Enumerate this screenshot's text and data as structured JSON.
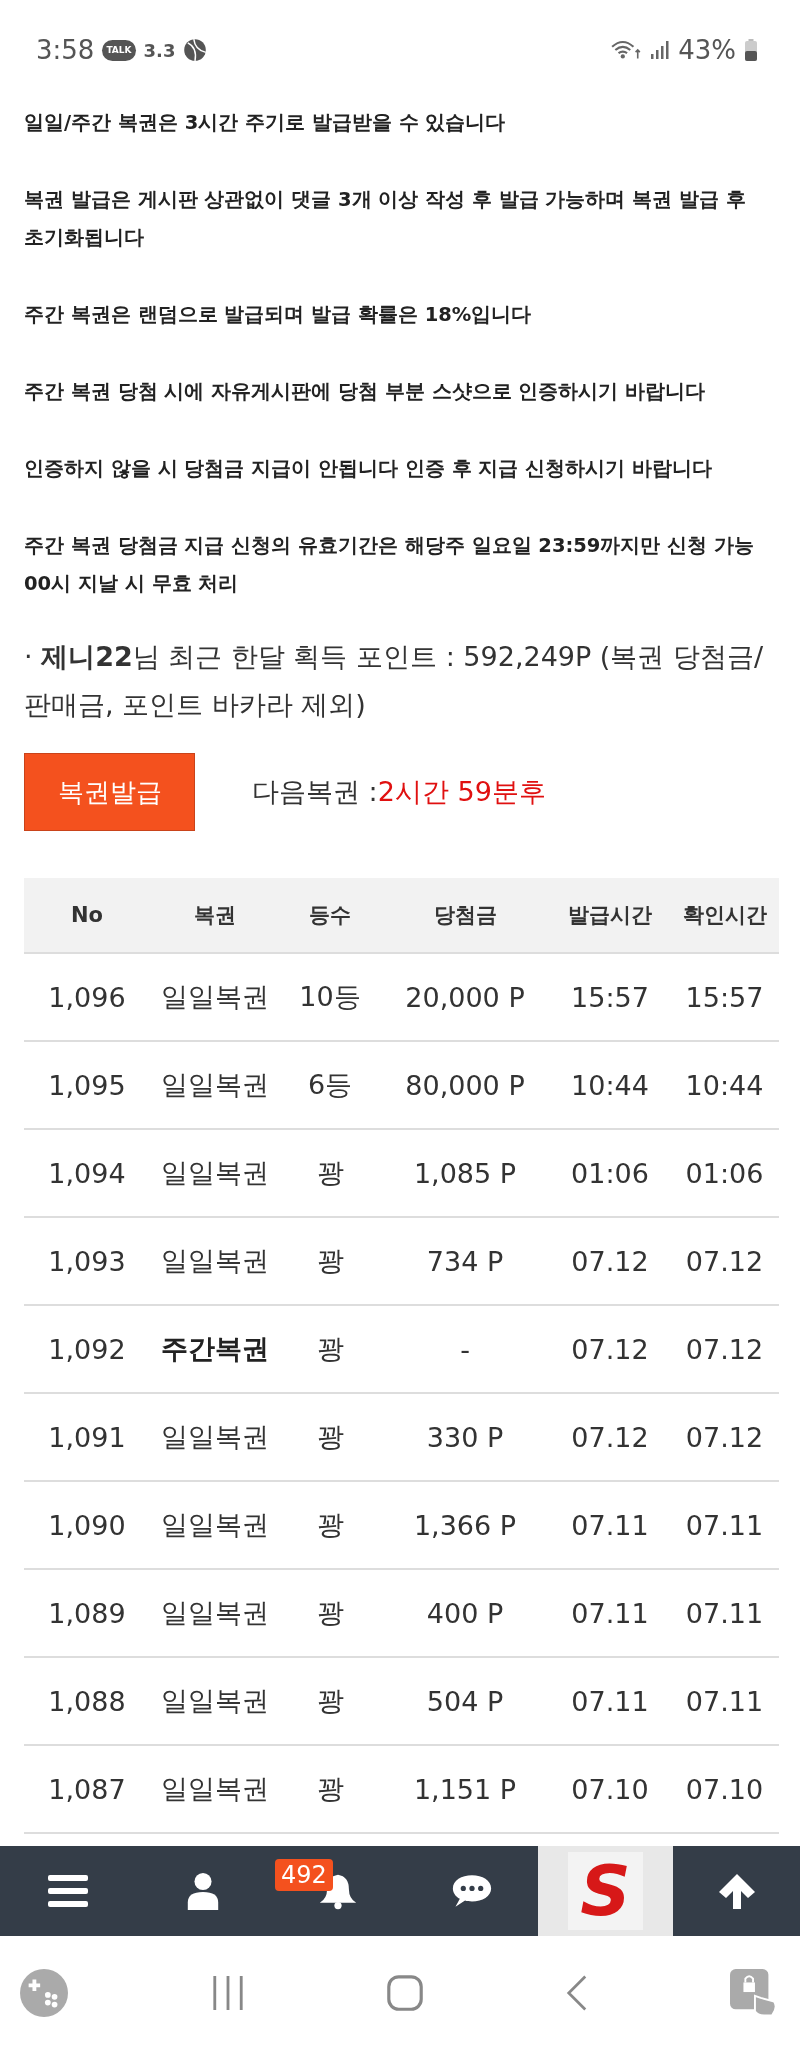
{
  "status_bar": {
    "time": "3:58",
    "talk_label": "TALK",
    "notification_text": "3.3",
    "battery": "43%"
  },
  "notices": [
    "일일/주간 복권은 3시간 주기로 발급받을 수 있습니다",
    "복권 발급은 게시판 상관없이 댓글 3개 이상 작성 후 발급 가능하며 복권 발급 후 초기화됩니다",
    "주간 복권은 랜덤으로 발급되며 발급 확률은 18%입니다",
    "주간 복권 당첨 시에 자유게시판에 당첨 부분 스샷으로 인증하시기 바랍니다",
    "인증하지 않을 시 당첨금 지급이 안됩니다 인증 후 지급 신청하시기 바랍니다",
    "주간 복권 당첨금 지급 신청의 유효기간은 해당주 일요일 23:59까지만 신청 가능 00시 지날 시 무효 처리"
  ],
  "points_info": "· **제니22**님 최근 한달 획득 포인트 : 592,249P (복권 당첨금/판매금, 포인트 바카라 제외)",
  "issue_button": "복권발급",
  "next_lottery": {
    "label": "다음복권 : ",
    "value": "2시간 59분후"
  },
  "table": {
    "columns": [
      "No",
      "복권",
      "등수",
      "당첨금",
      "발급시간",
      "확인시간"
    ],
    "rows": [
      {
        "kind": "daily",
        "cells": [
          "1,096",
          "일일복권",
          "10등",
          "20,000 P",
          "15:57",
          "15:57"
        ]
      },
      {
        "kind": "daily",
        "cells": [
          "1,095",
          "일일복권",
          "6등",
          "80,000 P",
          "10:44",
          "10:44"
        ]
      },
      {
        "kind": "daily",
        "cells": [
          "1,094",
          "일일복권",
          "꽝",
          "1,085 P",
          "01:06",
          "01:06"
        ]
      },
      {
        "kind": "daily",
        "cells": [
          "1,093",
          "일일복권",
          "꽝",
          "734 P",
          "07.12",
          "07.12"
        ]
      },
      {
        "kind": "weekly",
        "cells": [
          "1,092",
          "주간복권",
          "꽝",
          "-",
          "07.12",
          "07.12"
        ]
      },
      {
        "kind": "daily",
        "cells": [
          "1,091",
          "일일복권",
          "꽝",
          "330 P",
          "07.12",
          "07.12"
        ]
      },
      {
        "kind": "daily",
        "cells": [
          "1,090",
          "일일복권",
          "꽝",
          "1,366 P",
          "07.11",
          "07.11"
        ]
      },
      {
        "kind": "daily",
        "cells": [
          "1,089",
          "일일복권",
          "꽝",
          "400 P",
          "07.11",
          "07.11"
        ]
      },
      {
        "kind": "daily",
        "cells": [
          "1,088",
          "일일복권",
          "꽝",
          "504 P",
          "07.11",
          "07.11"
        ]
      },
      {
        "kind": "daily",
        "cells": [
          "1,087",
          "일일복권",
          "꽝",
          "1,151 P",
          "07.10",
          "07.10"
        ]
      }
    ]
  },
  "bottom_bar": {
    "badge": "492",
    "logo": "S"
  }
}
